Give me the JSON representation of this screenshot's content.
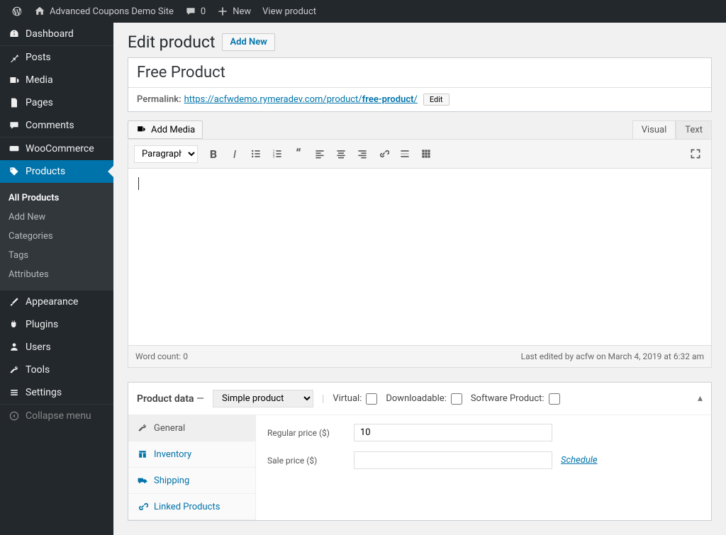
{
  "topbar": {
    "site_name": "Advanced Coupons Demo Site",
    "comments_count": "0",
    "new_label": "New",
    "view_product": "View product"
  },
  "sidebar": {
    "items": [
      {
        "label": "Dashboard"
      },
      {
        "label": "Posts"
      },
      {
        "label": "Media"
      },
      {
        "label": "Pages"
      },
      {
        "label": "Comments"
      },
      {
        "label": "WooCommerce"
      },
      {
        "label": "Products"
      }
    ],
    "submenu": [
      {
        "label": "All Products"
      },
      {
        "label": "Add New"
      },
      {
        "label": "Categories"
      },
      {
        "label": "Tags"
      },
      {
        "label": "Attributes"
      }
    ],
    "items2": [
      {
        "label": "Appearance"
      },
      {
        "label": "Plugins"
      },
      {
        "label": "Users"
      },
      {
        "label": "Tools"
      },
      {
        "label": "Settings"
      }
    ],
    "collapse": "Collapse menu"
  },
  "page": {
    "title": "Edit product",
    "add_new": "Add New"
  },
  "product": {
    "title_value": "Free Product",
    "permalink_label": "Permalink:",
    "permalink_base": "https://acfwdemo.rymeradev.com/product/",
    "permalink_slug": "free-product",
    "permalink_slash": "/",
    "edit_btn": "Edit"
  },
  "editor": {
    "add_media": "Add Media",
    "tab_visual": "Visual",
    "tab_text": "Text",
    "format": "Paragraph",
    "word_count_label": "Word count: ",
    "word_count": "0",
    "last_edited": "Last edited by acfw on March 4, 2019 at 6:32 am"
  },
  "product_data": {
    "heading": "Product data",
    "dash": " — ",
    "type": "Simple product",
    "virtual_label": "Virtual:",
    "downloadable_label": "Downloadable:",
    "software_label": "Software Product:",
    "tabs": {
      "general": "General",
      "inventory": "Inventory",
      "shipping": "Shipping",
      "linked": "Linked Products"
    },
    "regular_price_label": "Regular price ($)",
    "regular_price_value": "10",
    "sale_price_label": "Sale price ($)",
    "sale_price_value": "",
    "schedule": "Schedule"
  }
}
